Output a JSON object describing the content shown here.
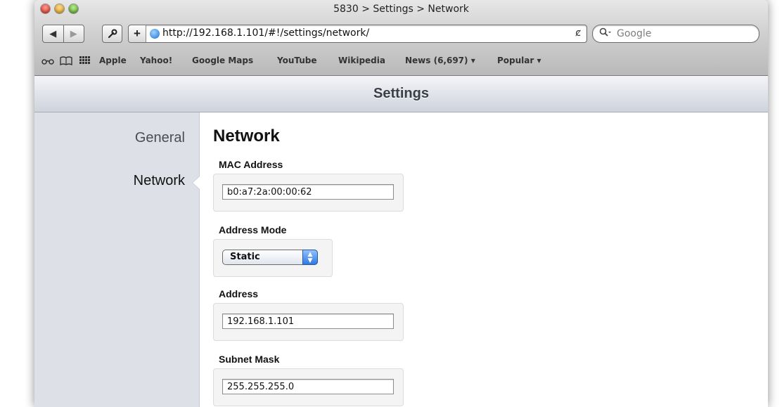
{
  "window": {
    "title": "5830 > Settings > Network"
  },
  "toolbar": {
    "back_icon": "◀",
    "forward_icon": "▶",
    "wrench_icon": "wrench-icon",
    "add_bookmark_icon": "+",
    "url": "http://192.168.1.101/#!/settings/network/",
    "reload_icon": "ȼ",
    "search_placeholder": "Google"
  },
  "bookmarks": {
    "reading_list_icon": "⌓",
    "items": [
      {
        "label": "Apple"
      },
      {
        "label": "Yahoo!"
      },
      {
        "label": "Google Maps"
      },
      {
        "label": "YouTube"
      },
      {
        "label": "Wikipedia"
      },
      {
        "label": "News (6,697) ▾"
      },
      {
        "label": "Popular ▾"
      }
    ]
  },
  "header": {
    "title": "Settings"
  },
  "sidebar": {
    "items": [
      {
        "label": "General",
        "active": false
      },
      {
        "label": "Network",
        "active": true
      }
    ]
  },
  "main": {
    "title": "Network",
    "fields": {
      "mac": {
        "label": "MAC Address",
        "value": "b0:a7:2a:00:00:62"
      },
      "mode": {
        "label": "Address Mode",
        "value": "Static"
      },
      "address": {
        "label": "Address",
        "value": "192.168.1.101"
      },
      "subnet": {
        "label": "Subnet Mask",
        "value": "255.255.255.0"
      }
    }
  }
}
